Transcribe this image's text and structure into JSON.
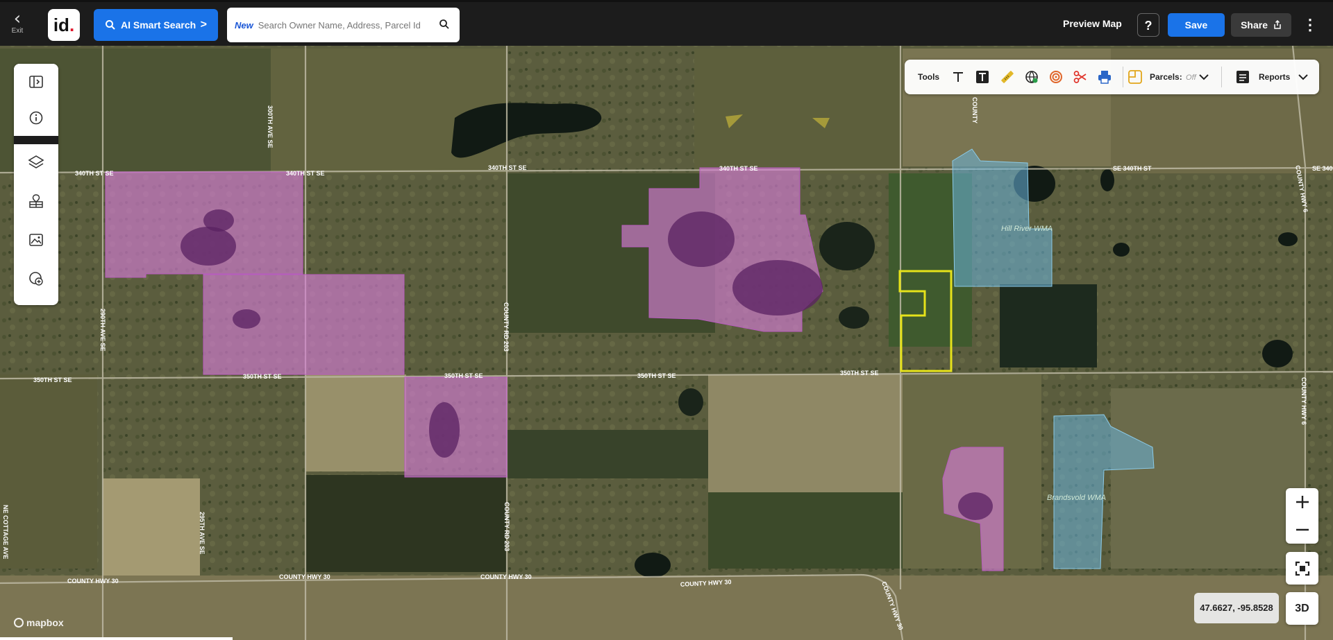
{
  "topbar": {
    "exit_label": "Exit",
    "logo_text": "id",
    "ai_search_label": "AI Smart Search",
    "search_new_tag": "New",
    "search_placeholder": "Search Owner Name, Address, Parcel Id",
    "preview_label": "Preview Map",
    "help_label": "?",
    "save_label": "Save",
    "share_label": "Share",
    "accent_color": "#1a73e8"
  },
  "sidebar": {
    "items": [
      {
        "name": "collapse-panel-icon"
      },
      {
        "name": "info-icon"
      },
      {
        "name": "layers-icon"
      },
      {
        "name": "map-pin-grid-icon"
      },
      {
        "name": "image-icon"
      },
      {
        "name": "add-location-icon"
      }
    ]
  },
  "toolbar": {
    "tools_label": "Tools",
    "icons": [
      "text-icon",
      "text-box-icon",
      "ruler-icon",
      "globe-icon",
      "radius-icon",
      "scissors-icon",
      "print-icon"
    ],
    "parcels_label": "Parcels:",
    "parcels_state": "Off",
    "reports_label": "Reports"
  },
  "map": {
    "attribution": "mapbox",
    "coordinates": "47.6627, -95.8528",
    "three_d_label": "3D",
    "road_labels": [
      "340TH ST SE",
      "340TH ST SE",
      "340TH ST SE",
      "340TH ST SE",
      "SE 340TH ST",
      "SE 340",
      "350TH ST SE",
      "350TH ST SE",
      "350TH ST SE",
      "350TH ST SE",
      "350TH ST SE",
      "COUNTY HWY 30",
      "COUNTY HWY 30",
      "COUNTY HWY 30",
      "COUNTY HWY 30",
      "COUNTY HWY 30",
      "300TH AVE SE",
      "290TH AVE SE",
      "295TH AVE SE",
      "COUNTY RD 203",
      "COUNTY RD 203",
      "COUNTY HWY 6",
      "COUNTY HWY 6",
      "NE COTTAGE AVE",
      "COUNTY"
    ],
    "wma_labels": [
      "Hill River WMA",
      "Brandsvold WMA"
    ],
    "colors": {
      "parcel_fill": "#d47cd4",
      "wma_fill": "#6ab4dc",
      "selected_outline": "#e6e21a"
    }
  }
}
